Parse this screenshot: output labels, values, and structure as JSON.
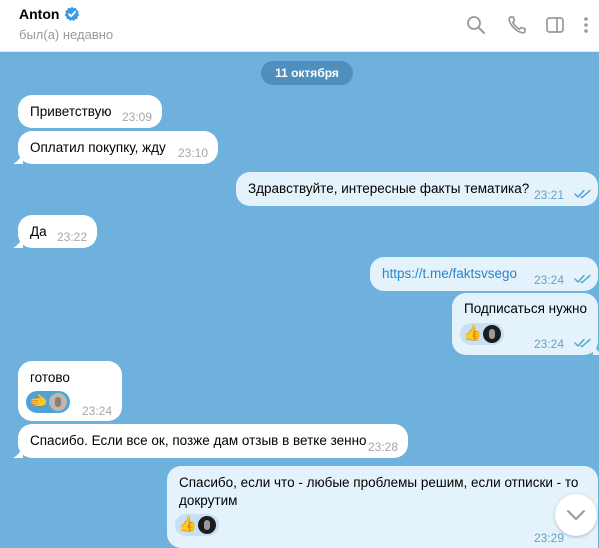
{
  "header": {
    "name": "Anton",
    "status": "был(а) недавно"
  },
  "date_badge": "11 октября",
  "messages": [
    {
      "text": "Приветствую",
      "time": "23:09",
      "dir": "in"
    },
    {
      "text": "Оплатил покупку, жду",
      "time": "23:10",
      "dir": "in"
    },
    {
      "text": "Здравствуйте, интересные факты тематика?",
      "time": "23:21",
      "dir": "out"
    },
    {
      "text": "Да",
      "time": "23:22",
      "dir": "in"
    },
    {
      "text": "https://t.me/faktsvsego",
      "time": "23:24",
      "dir": "out"
    },
    {
      "text": "Подписаться нужно",
      "time": "23:24",
      "dir": "out",
      "reactions": [
        "👍"
      ]
    },
    {
      "text": "готово",
      "time": "23:24",
      "dir": "in",
      "reactions": [
        "🫲"
      ]
    },
    {
      "text": "Спасибо. Если все ок, позже дам отзыв в ветке зенно",
      "time": "23:28",
      "dir": "in"
    },
    {
      "text_line1": "Спасибо, если что - любые проблемы решим, если отписки - то",
      "text_line2": "докрутим",
      "time": "23:29",
      "dir": "out",
      "reactions": [
        "👍"
      ]
    }
  ],
  "icons": {
    "verified": "verified-badge-icon",
    "search": "search-icon",
    "call": "phone-icon",
    "sidebar": "sidebar-toggle-icon",
    "more": "more-vertical-icon",
    "scroll_down": "chevron-down-icon"
  },
  "colors": {
    "chat_background": "#6fb1dd",
    "outgoing_bubble": "#e4f2fc",
    "incoming_bubble": "#ffffff",
    "accent": "#2a86c4",
    "date_badge": "#4f8fbd"
  }
}
